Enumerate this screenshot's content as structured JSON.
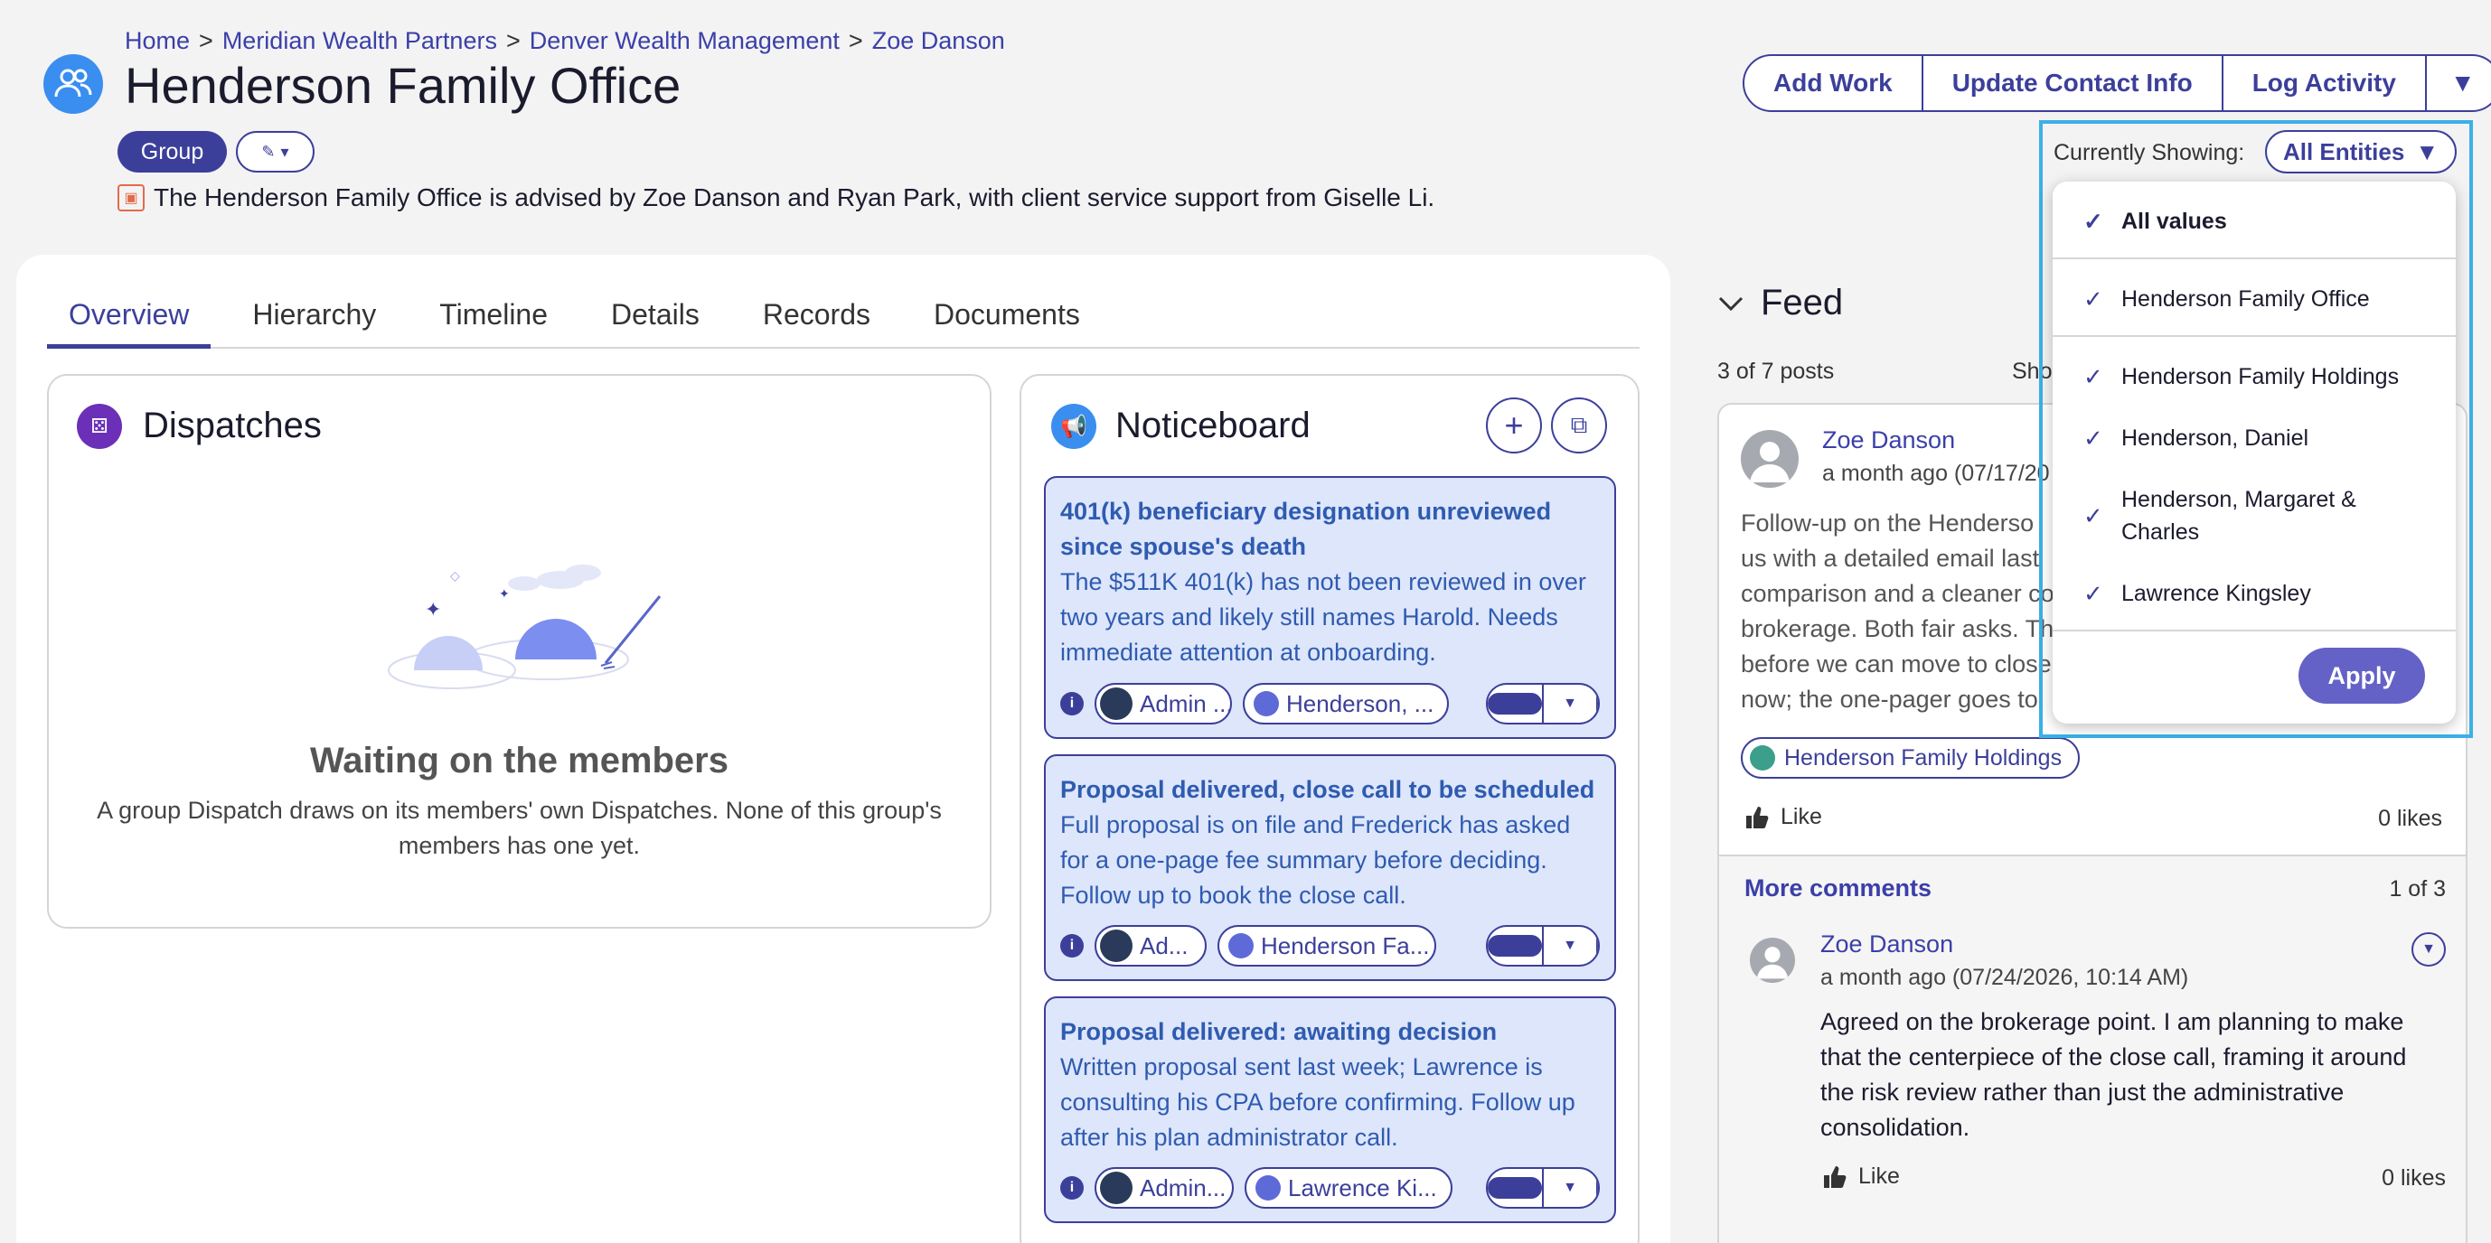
{
  "breadcrumb": {
    "items": [
      "Home",
      "Meridian Wealth Partners",
      "Denver Wealth Management",
      "Zoe Danson"
    ],
    "separator": ">"
  },
  "header": {
    "title": "Henderson Family Office",
    "group_label": "Group",
    "advised_text": "The Henderson Family Office is advised by Zoe Danson and Ryan Park, with client service support from Giselle Li.",
    "actions": [
      "Add Work",
      "Update Contact Info",
      "Log Activity"
    ],
    "currently_showing_label": "Currently Showing:",
    "entities_button": "All Entities"
  },
  "tabs": [
    "Overview",
    "Hierarchy",
    "Timeline",
    "Details",
    "Records",
    "Documents"
  ],
  "active_tab": "Overview",
  "dispatches": {
    "title": "Dispatches",
    "empty_title": "Waiting on the members",
    "empty_desc": "A group Dispatch draws on its members' own Dispatches. None of this group's members has one yet."
  },
  "noticeboard": {
    "title": "Noticeboard",
    "notices": [
      {
        "title": "401(k) beneficiary designation unreviewed since spouse's death",
        "body": "The $511K 401(k) has not been reviewed in over two years and likely still names Harold. Needs immediate attention at onboarding.",
        "chip1": "Admin ...",
        "chip2": "Henderson, ..."
      },
      {
        "title": "Proposal delivered, close call to be scheduled",
        "body": "Full proposal is on file and Frederick has asked for a one-page fee summary before deciding. Follow up to book the close call.",
        "chip1": "Ad...",
        "chip2": "Henderson Fa..."
      },
      {
        "title": "Proposal delivered: awaiting decision",
        "body": "Written proposal sent last week; Lawrence is consulting his CPA before confirming. Follow up after his plan administrator call.",
        "chip1": "Admin...",
        "chip2": "Lawrence Ki..."
      }
    ]
  },
  "feed": {
    "title": "Feed",
    "posts_count": "3 of 7 posts",
    "show_label": "Sho",
    "post": {
      "author": "Zoe Danson",
      "timestamp": "a month ago (07/17/20",
      "text_lines": [
        "Follow-up on the Henderso",
        "us with a detailed email last",
        "comparison and a cleaner co",
        "brokerage. Both fair asks. Th",
        "before we can move to close",
        "now; the one-pager goes to"
      ],
      "entity_chip": "Henderson Family Holdings",
      "like_label": "Like",
      "likes": "0 likes"
    },
    "comments": {
      "more_label": "More comments",
      "count": "1 of 3",
      "author": "Zoe Danson",
      "timestamp": "a month ago (07/24/2026, 10:14 AM)",
      "text": "Agreed on the brokerage point. I am planning to make that the centerpiece of the close call, framing it around the risk review rather than just the administrative consolidation.",
      "like_label": "Like",
      "likes": "0 likes"
    }
  },
  "entity_dropdown": {
    "items": [
      {
        "label": "All values",
        "checked": true
      },
      {
        "label": "Henderson Family Office",
        "checked": true
      },
      {
        "label": "Henderson Family Holdings",
        "checked": true
      },
      {
        "label": "Henderson, Daniel",
        "checked": true
      },
      {
        "label": "Henderson, Margaret & Charles",
        "checked": true
      },
      {
        "label": "Lawrence Kingsley",
        "checked": true
      }
    ],
    "apply_label": "Apply"
  },
  "colors": {
    "accent": "#3c3f9a",
    "notice_bg": "#dde6fb",
    "highlight": "#3ab0e8",
    "apply": "#6462c6"
  }
}
